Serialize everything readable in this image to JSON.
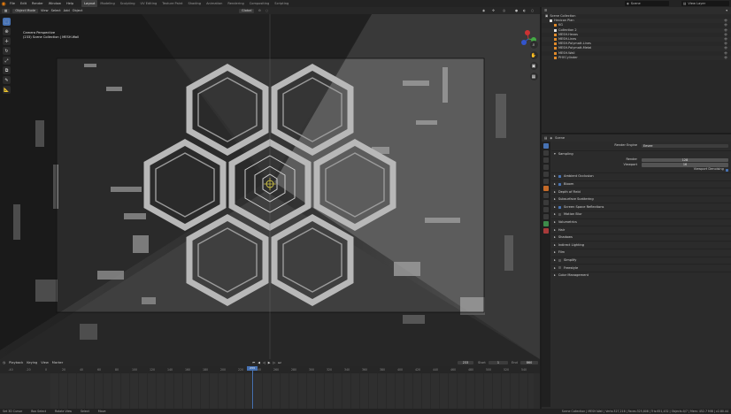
{
  "menu": [
    "File",
    "Edit",
    "Render",
    "Window",
    "Help"
  ],
  "workspaces": [
    "Layout",
    "Modeling",
    "Sculpting",
    "UV Editing",
    "Texture Paint",
    "Shading",
    "Animation",
    "Rendering",
    "Compositing",
    "Scripting"
  ],
  "scene_name": "Scene",
  "view_layer": "View Layer",
  "viewport": {
    "mode": "Object Mode",
    "menus": [
      "View",
      "Select",
      "Add",
      "Object"
    ],
    "transform": "Global",
    "camera_title": "Camera Perspective",
    "camera_sub": "(233) Scene Collection | MESH.Wall"
  },
  "tool_icons": [
    "select-box-icon",
    "cursor-icon",
    "move-icon",
    "rotate-icon",
    "scale-icon",
    "transform-icon",
    "annotate-icon",
    "measure-icon"
  ],
  "outliner": {
    "title": "Scene Collection",
    "rows": [
      {
        "label": "Hexicon Plan",
        "indent": 1,
        "color": "#e0e0e0"
      },
      {
        "label": "KG",
        "indent": 2,
        "color": "#e08a2a"
      },
      {
        "label": "Collection 2",
        "indent": 2,
        "color": "#e0e0e0"
      },
      {
        "label": "MESH.Hexas",
        "indent": 2,
        "color": "#e08a2a"
      },
      {
        "label": "MESH.Lines",
        "indent": 2,
        "color": "#e08a2a"
      },
      {
        "label": "MESH.Polymatt.Lines",
        "indent": 2,
        "color": "#e08a2a"
      },
      {
        "label": "MESH.Polymatt.Metal",
        "indent": 2,
        "color": "#e08a2a"
      },
      {
        "label": "MESH.Wall",
        "indent": 2,
        "color": "#e08a2a"
      },
      {
        "label": "PHY.Cylinder",
        "indent": 2,
        "color": "#e08a2a"
      }
    ]
  },
  "properties": {
    "title": "Scene",
    "render_engine_label": "Render Engine",
    "render_engine": "Eevee",
    "sampling": "Sampling",
    "render_label": "Render",
    "render_value": "128",
    "viewport_label": "Viewport",
    "viewport_value": "16",
    "viewport_denoising": "Viewport Denoising",
    "sections": [
      {
        "label": "Ambient Occlusion",
        "check": true
      },
      {
        "label": "Bloom",
        "check": true
      },
      {
        "label": "Depth of Field",
        "check": null
      },
      {
        "label": "Subsurface Scattering",
        "check": null
      },
      {
        "label": "Screen Space Reflections",
        "check": true
      },
      {
        "label": "Motion Blur",
        "check": false
      },
      {
        "label": "Volumetrics",
        "check": null
      },
      {
        "label": "Hair",
        "check": null
      },
      {
        "label": "Shadows",
        "check": null
      },
      {
        "label": "Indirect Lighting",
        "check": null
      },
      {
        "label": "Film",
        "check": null
      },
      {
        "label": "Simplify",
        "check": false
      },
      {
        "label": "Freestyle",
        "check": false
      },
      {
        "label": "Color Management",
        "check": null
      }
    ]
  },
  "timeline": {
    "menus": [
      "Playback",
      "Keying",
      "View",
      "Marker"
    ],
    "current_frame": "233",
    "start_label": "Start",
    "start": "1",
    "end_label": "End",
    "end": "860",
    "ticks": [
      "-40",
      "-20",
      "0",
      "20",
      "40",
      "60",
      "80",
      "100",
      "120",
      "140",
      "160",
      "180",
      "200",
      "220",
      "240",
      "260",
      "280",
      "300",
      "320",
      "340",
      "360",
      "380",
      "400",
      "420",
      "440",
      "460",
      "480",
      "500",
      "520",
      "540"
    ]
  },
  "status": [
    "Set 3D Cursor",
    "Box Select",
    "Rotate View",
    "Select",
    "Move"
  ],
  "status_right": "Scene Collection | MESH.Wall | Verts:327,216 | Faces:325,808 | Tris:651,432 | Objects:0/7 | Mem: 452.7 MiB | v2.80.44"
}
